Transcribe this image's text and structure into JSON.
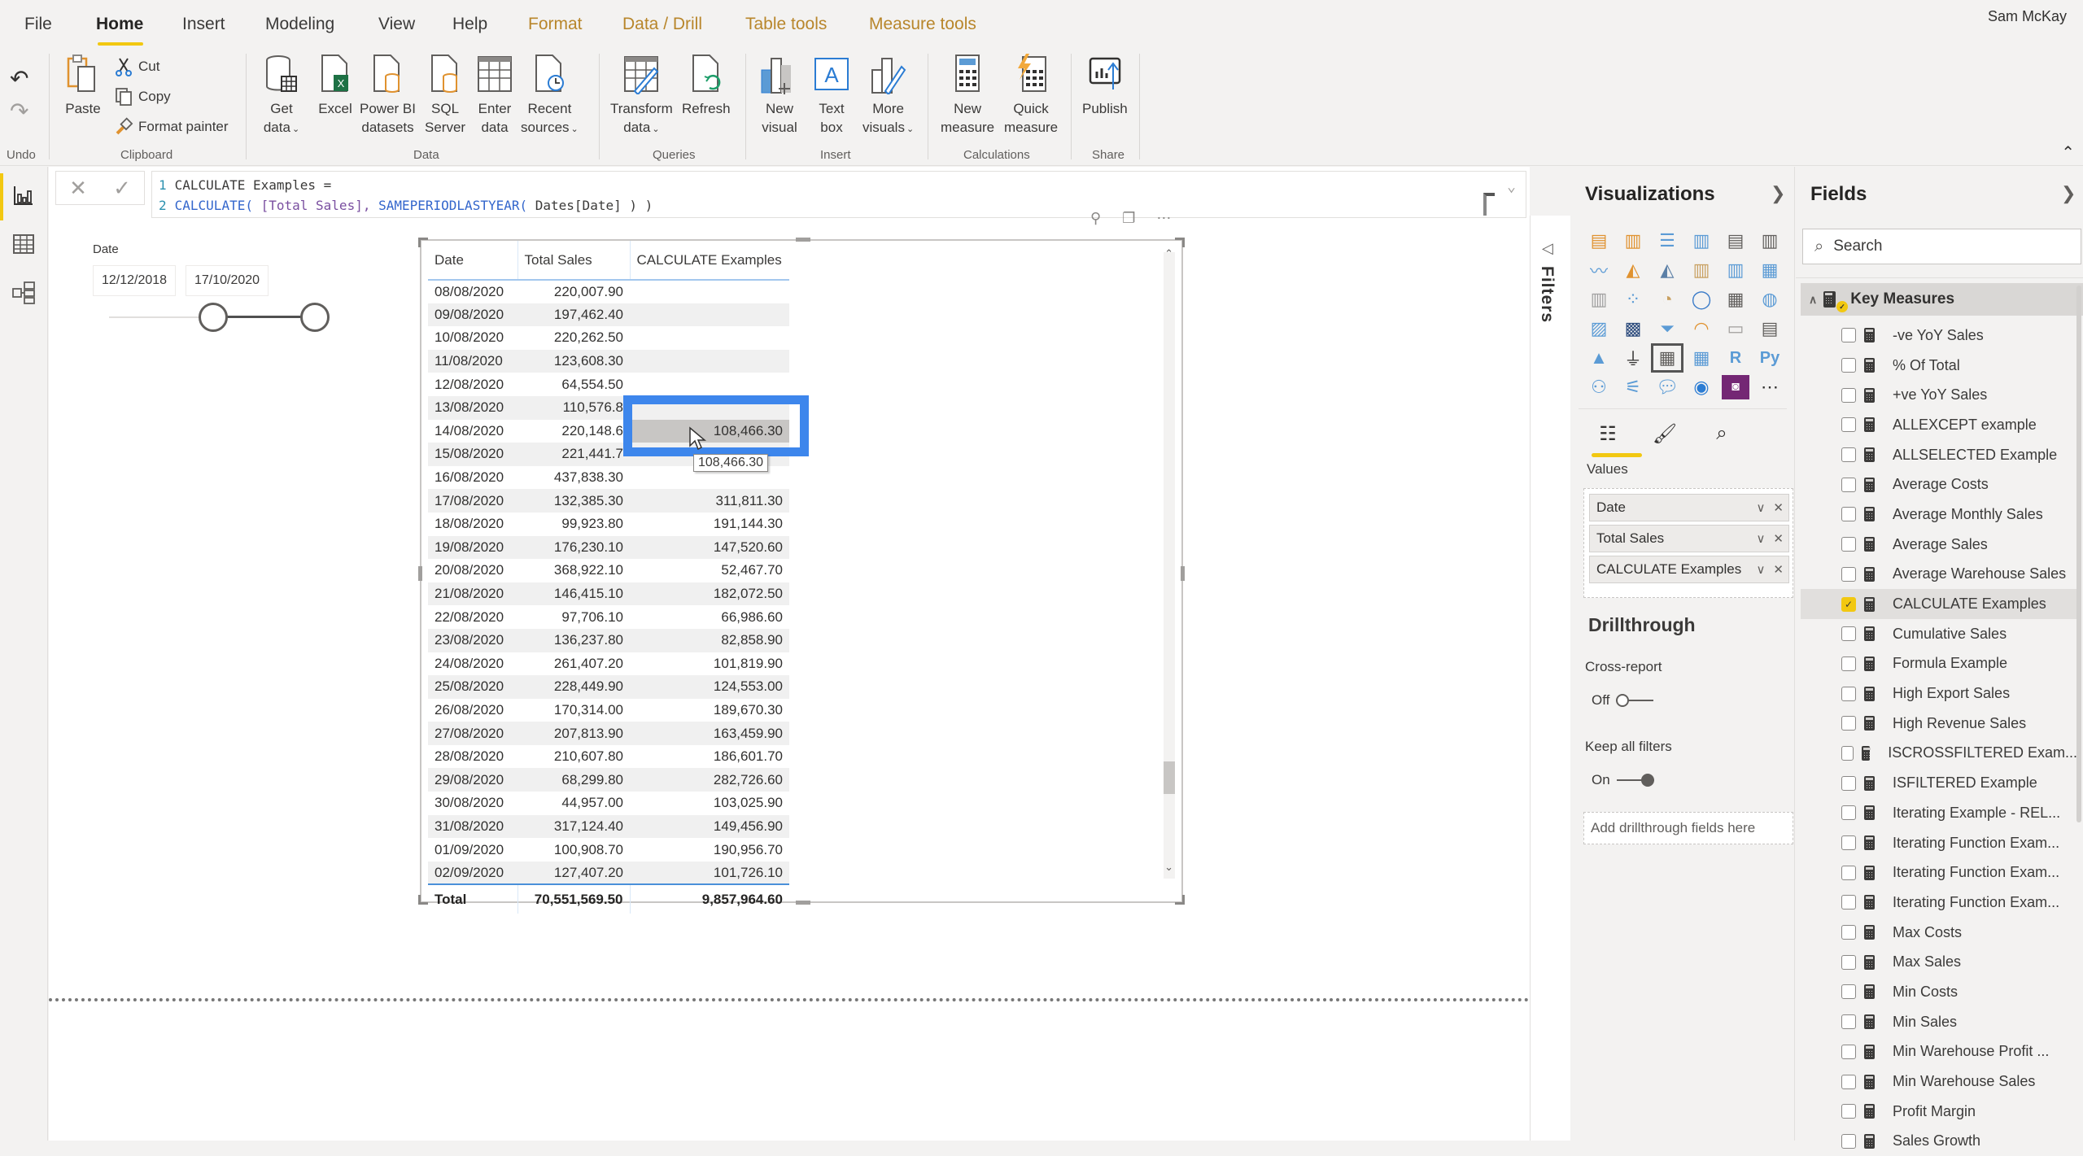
{
  "user": {
    "name": "Sam McKay"
  },
  "tabs": [
    {
      "label": "File",
      "active": false,
      "contextual": false
    },
    {
      "label": "Home",
      "active": true,
      "contextual": false
    },
    {
      "label": "Insert",
      "active": false,
      "contextual": false
    },
    {
      "label": "Modeling",
      "active": false,
      "contextual": false
    },
    {
      "label": "View",
      "active": false,
      "contextual": false
    },
    {
      "label": "Help",
      "active": false,
      "contextual": false
    },
    {
      "label": "Format",
      "active": false,
      "contextual": true
    },
    {
      "label": "Data / Drill",
      "active": false,
      "contextual": true
    },
    {
      "label": "Table tools",
      "active": false,
      "contextual": true
    },
    {
      "label": "Measure tools",
      "active": false,
      "contextual": true
    }
  ],
  "ribbon": {
    "undo": {
      "group": "Undo"
    },
    "clipboard": {
      "group": "Clipboard",
      "paste": "Paste",
      "cut": "Cut",
      "copy": "Copy",
      "format_painter": "Format painter"
    },
    "data": {
      "group": "Data",
      "get_data": [
        "Get",
        "data"
      ],
      "excel": "Excel",
      "pbi_datasets": [
        "Power BI",
        "datasets"
      ],
      "sql": [
        "SQL",
        "Server"
      ],
      "enter_data": [
        "Enter",
        "data"
      ],
      "recent": [
        "Recent",
        "sources"
      ]
    },
    "queries": {
      "group": "Queries",
      "transform": [
        "Transform",
        "data"
      ],
      "refresh": "Refresh"
    },
    "insert": {
      "group": "Insert",
      "new_visual": [
        "New",
        "visual"
      ],
      "text_box": [
        "Text",
        "box"
      ],
      "more_visuals": [
        "More",
        "visuals"
      ]
    },
    "calculations": {
      "group": "Calculations",
      "new_measure": [
        "New",
        "measure"
      ],
      "quick_measure": [
        "Quick",
        "measure"
      ]
    },
    "share": {
      "group": "Share",
      "publish": "Publish"
    }
  },
  "formula": {
    "line1_no": "1",
    "line1": "CALCULATE Examples =",
    "line2_no": "2",
    "line2_fn": "CALCULATE(",
    "line2_arg1": " [Total Sales], ",
    "line2_fn2": "SAMEPERIODLASTYEAR(",
    "line2_arg2": " Dates[Date] ) )"
  },
  "slicer": {
    "label": "Date",
    "start": "12/12/2018",
    "end": "17/10/2020",
    "range_fraction": [
      0.48,
      0.95
    ]
  },
  "table": {
    "columns": [
      "Date",
      "Total Sales",
      "CALCULATE Examples"
    ],
    "rows": [
      [
        "08/08/2020",
        "220,007.90",
        ""
      ],
      [
        "09/08/2020",
        "197,462.40",
        ""
      ],
      [
        "10/08/2020",
        "220,262.50",
        ""
      ],
      [
        "11/08/2020",
        "123,608.30",
        ""
      ],
      [
        "12/08/2020",
        "64,554.50",
        ""
      ],
      [
        "13/08/2020",
        "110,576.8",
        ""
      ],
      [
        "14/08/2020",
        "220,148.6",
        "108,466.30"
      ],
      [
        "15/08/2020",
        "221,441.7",
        ""
      ],
      [
        "16/08/2020",
        "437,838.30",
        ""
      ],
      [
        "17/08/2020",
        "132,385.30",
        "311,811.30"
      ],
      [
        "18/08/2020",
        "99,923.80",
        "191,144.30"
      ],
      [
        "19/08/2020",
        "176,230.10",
        "147,520.60"
      ],
      [
        "20/08/2020",
        "368,922.10",
        "52,467.70"
      ],
      [
        "21/08/2020",
        "146,415.10",
        "182,072.50"
      ],
      [
        "22/08/2020",
        "97,706.10",
        "66,986.60"
      ],
      [
        "23/08/2020",
        "136,237.80",
        "82,858.90"
      ],
      [
        "24/08/2020",
        "261,407.20",
        "101,819.90"
      ],
      [
        "25/08/2020",
        "228,449.90",
        "124,553.00"
      ],
      [
        "26/08/2020",
        "170,314.00",
        "189,670.30"
      ],
      [
        "27/08/2020",
        "207,813.90",
        "163,459.90"
      ],
      [
        "28/08/2020",
        "210,607.80",
        "186,601.70"
      ],
      [
        "29/08/2020",
        "68,299.80",
        "282,726.60"
      ],
      [
        "30/08/2020",
        "44,957.00",
        "103,025.90"
      ],
      [
        "31/08/2020",
        "317,124.40",
        "149,456.90"
      ],
      [
        "01/09/2020",
        "100,908.70",
        "190,956.70"
      ],
      [
        "02/09/2020",
        "127,407.20",
        "101,726.10"
      ]
    ],
    "selected_row": 6,
    "total": [
      "Total",
      "70,551,569.50",
      "9,857,964.60"
    ],
    "tooltip": "108,466.30",
    "highlight_color": "#3d86ec"
  },
  "filters": {
    "label": "Filters"
  },
  "visualizations": {
    "title": "Visualizations",
    "values_label": "Values",
    "value_fields": [
      "Date",
      "Total Sales",
      "CALCULATE Examples"
    ],
    "drillthrough": {
      "title": "Drillthrough",
      "cross_report_label": "Cross-report",
      "cross_report_state": "Off",
      "keep_filters_label": "Keep all filters",
      "keep_filters_state": "On",
      "drop_placeholder": "Add drillthrough fields here"
    }
  },
  "fields": {
    "title": "Fields",
    "search_placeholder": "Search",
    "table_name": "Key Measures",
    "items": [
      {
        "label": "-ve YoY Sales",
        "checked": false
      },
      {
        "label": "% Of Total",
        "checked": false
      },
      {
        "label": "+ve YoY Sales",
        "checked": false
      },
      {
        "label": "ALLEXCEPT example",
        "checked": false
      },
      {
        "label": "ALLSELECTED Example",
        "checked": false
      },
      {
        "label": "Average Costs",
        "checked": false
      },
      {
        "label": "Average Monthly Sales",
        "checked": false
      },
      {
        "label": "Average Sales",
        "checked": false
      },
      {
        "label": "Average Warehouse Sales",
        "checked": false
      },
      {
        "label": "CALCULATE Examples",
        "checked": true
      },
      {
        "label": "Cumulative Sales",
        "checked": false
      },
      {
        "label": "Formula Example",
        "checked": false
      },
      {
        "label": "High Export Sales",
        "checked": false
      },
      {
        "label": "High Revenue Sales",
        "checked": false
      },
      {
        "label": "ISCROSSFILTERED Exam...",
        "checked": false
      },
      {
        "label": "ISFILTERED Example",
        "checked": false
      },
      {
        "label": "Iterating Example - REL...",
        "checked": false
      },
      {
        "label": "Iterating Function Exam...",
        "checked": false
      },
      {
        "label": "Iterating Function Exam...",
        "checked": false
      },
      {
        "label": "Iterating Function Exam...",
        "checked": false
      },
      {
        "label": "Max Costs",
        "checked": false
      },
      {
        "label": "Max Sales",
        "checked": false
      },
      {
        "label": "Min Costs",
        "checked": false
      },
      {
        "label": "Min Sales",
        "checked": false
      },
      {
        "label": "Min Warehouse Profit ...",
        "checked": false
      },
      {
        "label": "Min Warehouse Sales",
        "checked": false
      },
      {
        "label": "Profit Margin",
        "checked": false
      },
      {
        "label": "Sales Growth",
        "checked": false
      }
    ]
  }
}
